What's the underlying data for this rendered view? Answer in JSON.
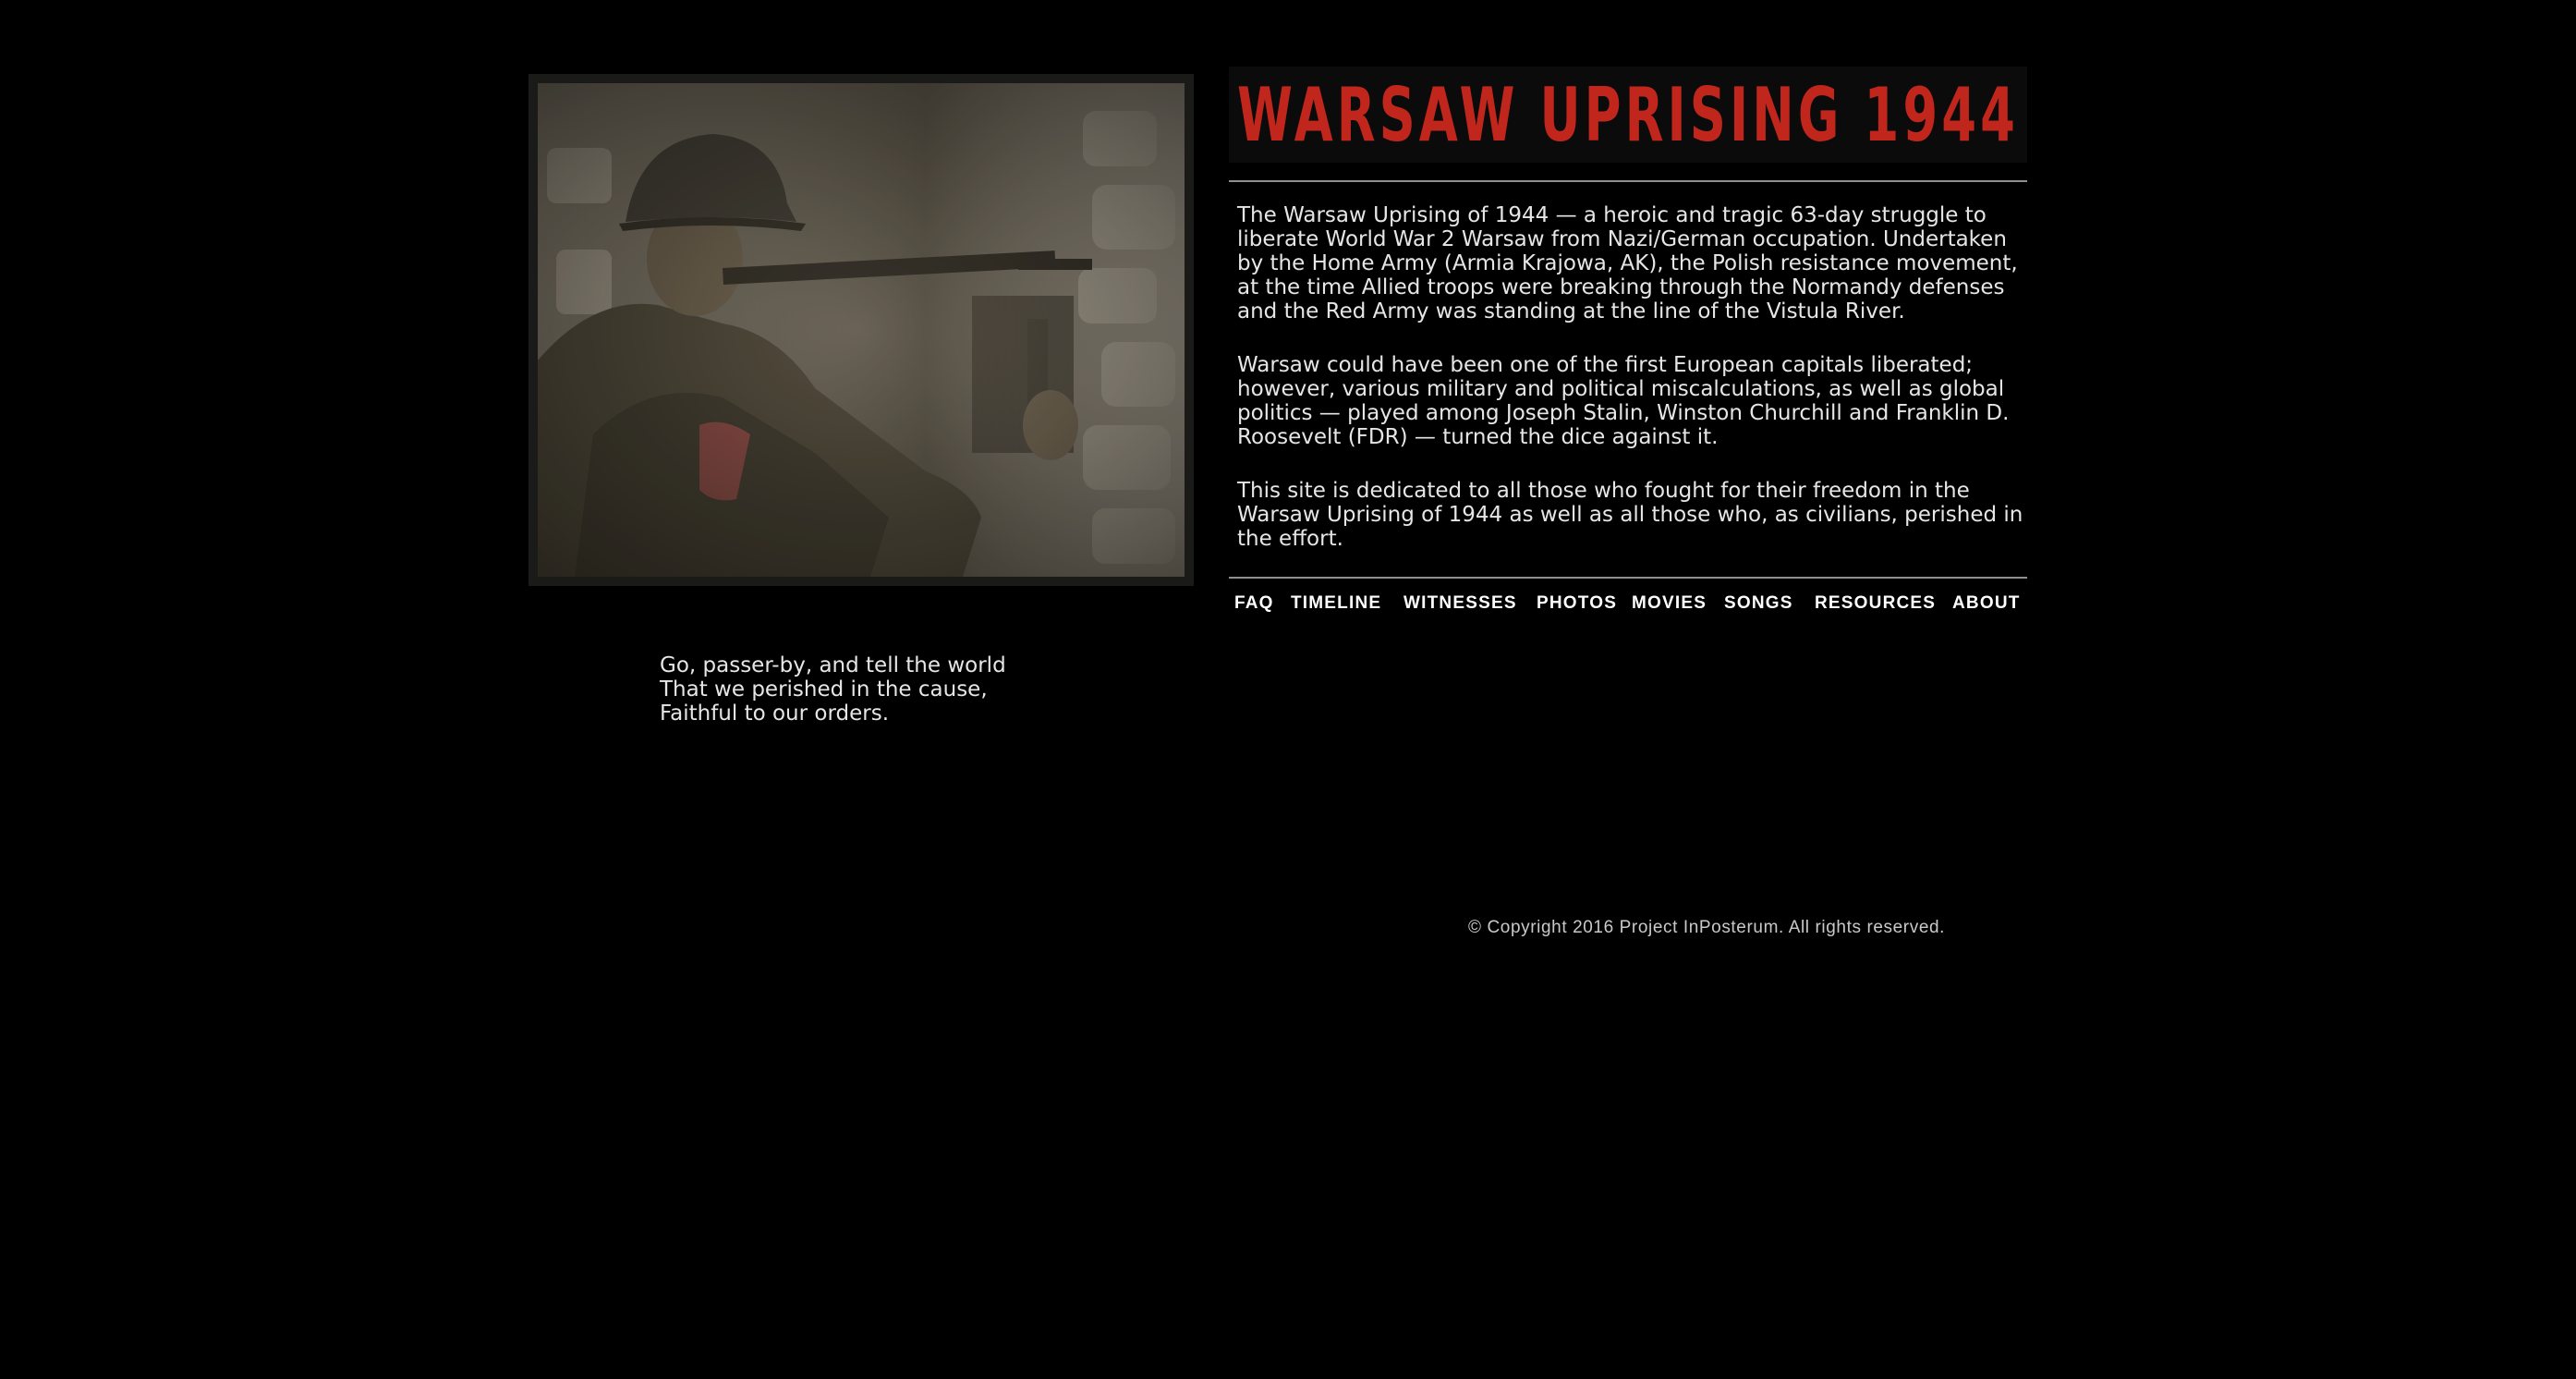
{
  "header": {
    "title": "WARSAW UPRISING 1944",
    "title_color": "#c0261c"
  },
  "hero_image": {
    "description_icon": "soldier-photo"
  },
  "intro": {
    "paragraphs": [
      "The Warsaw Uprising of 1944 — a heroic and tragic 63-day struggle to liberate World War 2 Warsaw from Nazi/German occupation. Undertaken by the Home Army (Armia Krajowa, AK), the Polish resistance movement, at the time Allied troops were breaking through the Normandy defenses and the Red Army was standing at the line of the Vistula River.",
      "Warsaw could have been one of the first European capitals liberated; however, various military and political miscalculations, as well as global politics — played among Joseph Stalin, Winston Churchill and Franklin D. Roosevelt (FDR) — turned the dice against it.",
      "This site is dedicated to all those who fought for their freedom in the Warsaw Uprising of 1944 as well as all those who, as civilians, perished in the effort."
    ]
  },
  "nav": {
    "items": [
      "FAQ",
      "TIMELINE",
      "WITNESSES",
      "PHOTOS",
      "MOVIES",
      "SONGS",
      "RESOURCES",
      "ABOUT"
    ]
  },
  "poem": {
    "lines": [
      "Go, passer-by, and tell the world",
      "That we perished in the cause,",
      "Faithful to our orders."
    ]
  },
  "footer": {
    "copyright_prefix": "© Copyright 2016 ",
    "project_link": "Project InPosterum",
    "copyright_suffix": ". All rights reserved."
  }
}
